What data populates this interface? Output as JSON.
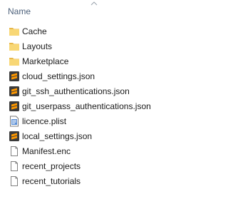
{
  "header": {
    "column_label": "Name",
    "sort_icon": "chevron-up-icon"
  },
  "files": [
    {
      "name": "Cache",
      "icon": "folder-icon"
    },
    {
      "name": "Layouts",
      "icon": "folder-icon"
    },
    {
      "name": "Marketplace",
      "icon": "folder-icon"
    },
    {
      "name": "cloud_settings.json",
      "icon": "sublime-file-icon"
    },
    {
      "name": "git_ssh_authentications.json",
      "icon": "sublime-file-icon"
    },
    {
      "name": "git_userpass_authentications.json",
      "icon": "sublime-file-icon"
    },
    {
      "name": "licence.plist",
      "icon": "plist-file-icon"
    },
    {
      "name": "local_settings.json",
      "icon": "sublime-file-icon"
    },
    {
      "name": "Manifest.enc",
      "icon": "blank-file-icon"
    },
    {
      "name": "recent_projects",
      "icon": "blank-file-icon"
    },
    {
      "name": "recent_tutorials",
      "icon": "blank-file-icon"
    }
  ],
  "colors": {
    "folder": "#f8d775",
    "folder_tab": "#e8b84a",
    "sublime_bg": "#3b3b3b",
    "sublime_accent": "#ff9800",
    "header_text": "#4c607a"
  }
}
